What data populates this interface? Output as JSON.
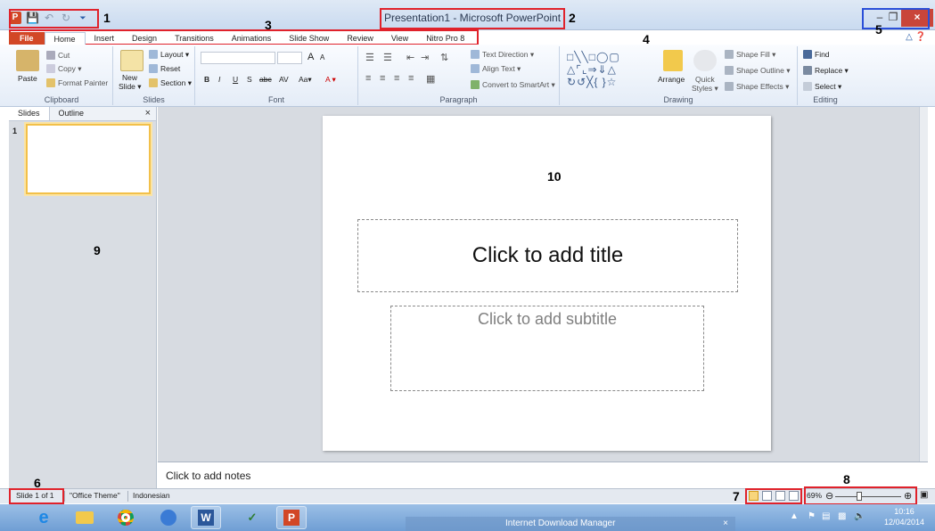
{
  "title_bar": {
    "app_icon_letter": "P",
    "window_title": "Presentation1 - Microsoft PowerPoint",
    "minimize": "–",
    "restore": "❐",
    "close": "×"
  },
  "annotations": {
    "a1": "1",
    "a2": "2",
    "a3": "3",
    "a4": "4",
    "a5": "5",
    "a6": "6",
    "a7": "7",
    "a8": "8",
    "a9": "9",
    "a10": "10"
  },
  "ribbon_tabs": [
    "File",
    "Home",
    "Insert",
    "Design",
    "Transitions",
    "Animations",
    "Slide Show",
    "Review",
    "View",
    "Nitro Pro 8"
  ],
  "ribbon": {
    "clipboard": {
      "paste": "Paste",
      "cut": "Cut",
      "copy": "Copy ▾",
      "format_painter": "Format Painter",
      "label": "Clipboard"
    },
    "slides": {
      "new_slide": "New",
      "new_slide2": "Slide ▾",
      "layout": "Layout ▾",
      "reset": "Reset",
      "section": "Section ▾",
      "label": "Slides"
    },
    "font": {
      "bold": "B",
      "italic": "I",
      "underline": "U",
      "strike": "S",
      "abc": "abc",
      "spacing": "AV",
      "case": "Aa▾",
      "color": "A ▾",
      "grow": "A",
      "shrink": "A",
      "label": "Font"
    },
    "paragraph": {
      "text_direction": "Text Direction ▾",
      "align_text": "Align Text ▾",
      "convert": "Convert to SmartArt ▾",
      "label": "Paragraph"
    },
    "drawing": {
      "arrange": "Arrange",
      "quick_styles": "Quick",
      "quick_styles2": "Styles ▾",
      "shape_fill": "Shape Fill ▾",
      "shape_outline": "Shape Outline ▾",
      "shape_effects": "Shape Effects ▾",
      "label": "Drawing"
    },
    "editing": {
      "find": "Find",
      "replace": "Replace ▾",
      "select": "Select ▾",
      "label": "Editing"
    }
  },
  "left_pane": {
    "tab_slides": "Slides",
    "tab_outline": "Outline",
    "close": "×",
    "thumb_number": "1"
  },
  "slide": {
    "title_placeholder": "Click to add title",
    "subtitle_placeholder": "Click to add subtitle"
  },
  "notes": {
    "placeholder": "Click to add notes"
  },
  "status_bar": {
    "slide_info": "Slide 1 of 1",
    "theme": "\"Office Theme\"",
    "language": "Indonesian",
    "zoom": "69%"
  },
  "taskbar": {
    "idm_label": "Internet Download Manager",
    "idm_close": "×",
    "time": "10:16",
    "date": "12/04/2014"
  }
}
